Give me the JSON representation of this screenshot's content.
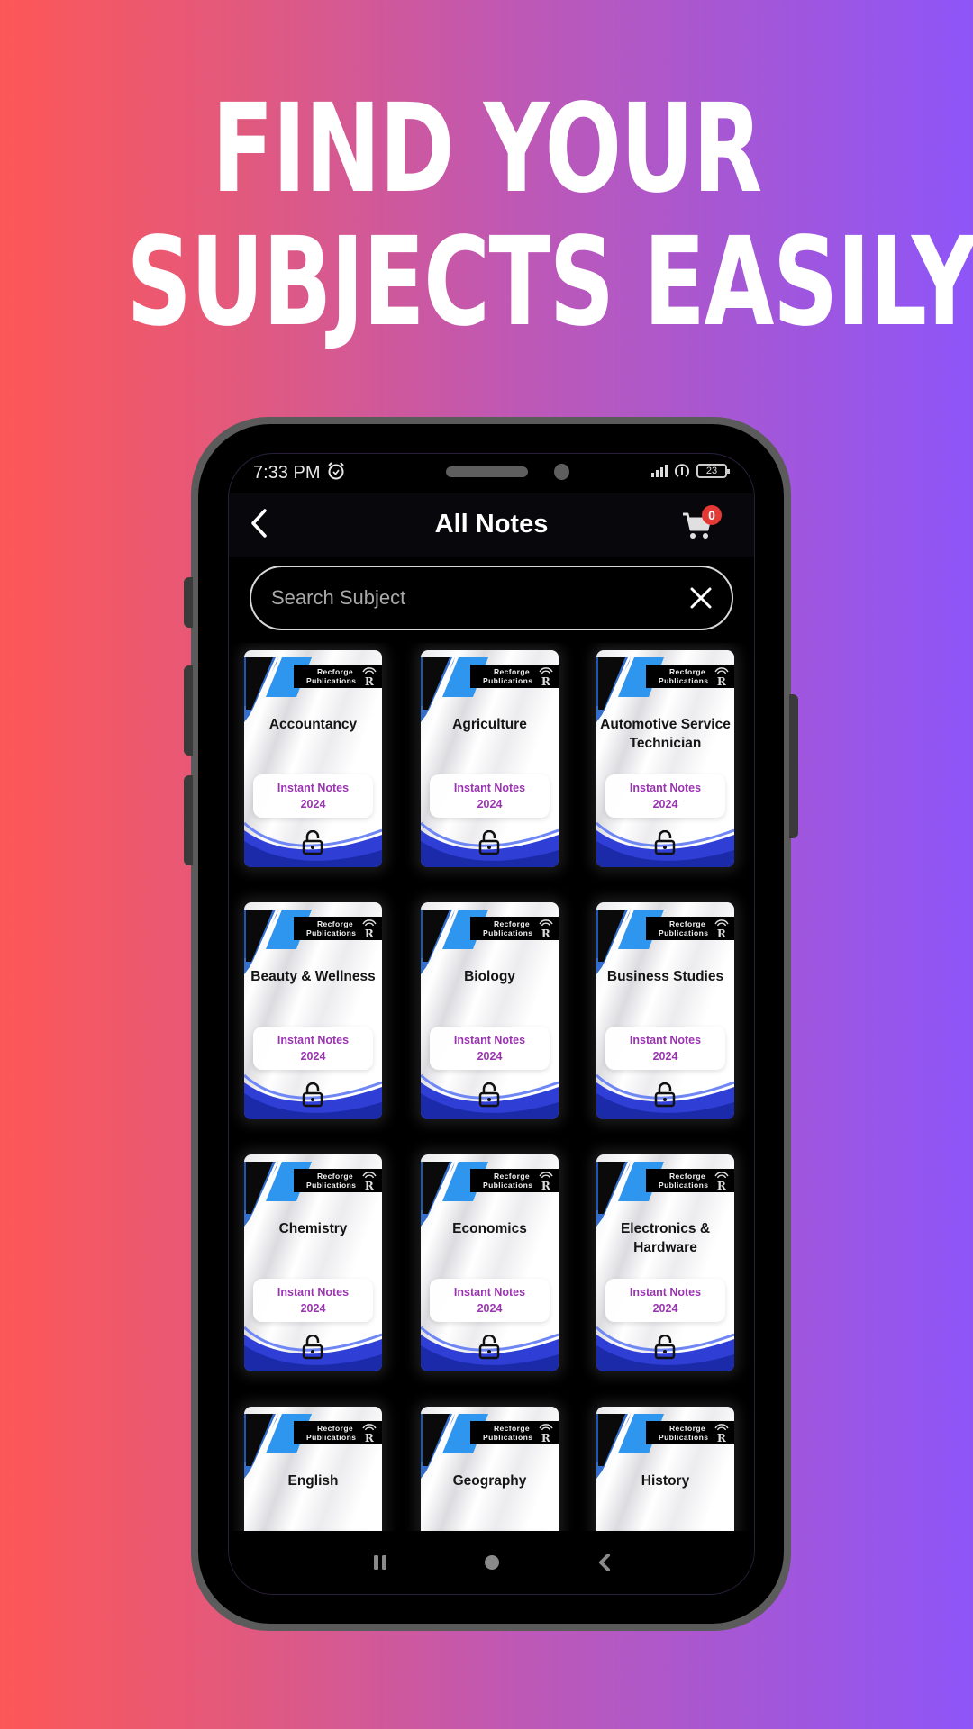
{
  "headline": {
    "line1": "FIND YOUR",
    "line2": "SUBJECTS EASILY"
  },
  "colors": {
    "gradient_start": "#fd5757",
    "gradient_end": "#8e55f8",
    "card_accent_blue": "#2f96f0",
    "card_wave_blue": "#2f3fd6",
    "pill_text": "#9b34b2",
    "badge_red": "#e53935"
  },
  "status_bar": {
    "time": "7:33 PM",
    "alarm_icon": "alarm-clock-icon",
    "battery": "23"
  },
  "header": {
    "title": "All Notes",
    "back_icon": "chevron-left-icon",
    "cart_icon": "cart-icon",
    "cart_count": "0"
  },
  "search": {
    "placeholder": "Search Subject",
    "value": "",
    "clear_icon": "close-icon"
  },
  "card_common": {
    "brand_line1": "Recforge",
    "brand_line2": "Publications",
    "pill_line1": "Instant Notes",
    "pill_line2": "2024",
    "lock_icon": "unlocked-padlock-icon"
  },
  "subjects": [
    "Accountancy",
    "Agriculture",
    "Automotive Service Technician",
    "Beauty & Wellness",
    "Biology",
    "Business Studies",
    "Chemistry",
    "Economics",
    "Electronics & Hardware",
    "English",
    "Geography",
    "History"
  ],
  "nav_bar": {
    "recents_icon": "recents-icon",
    "home_icon": "home-circle-icon",
    "back_icon": "back-triangle-icon"
  }
}
